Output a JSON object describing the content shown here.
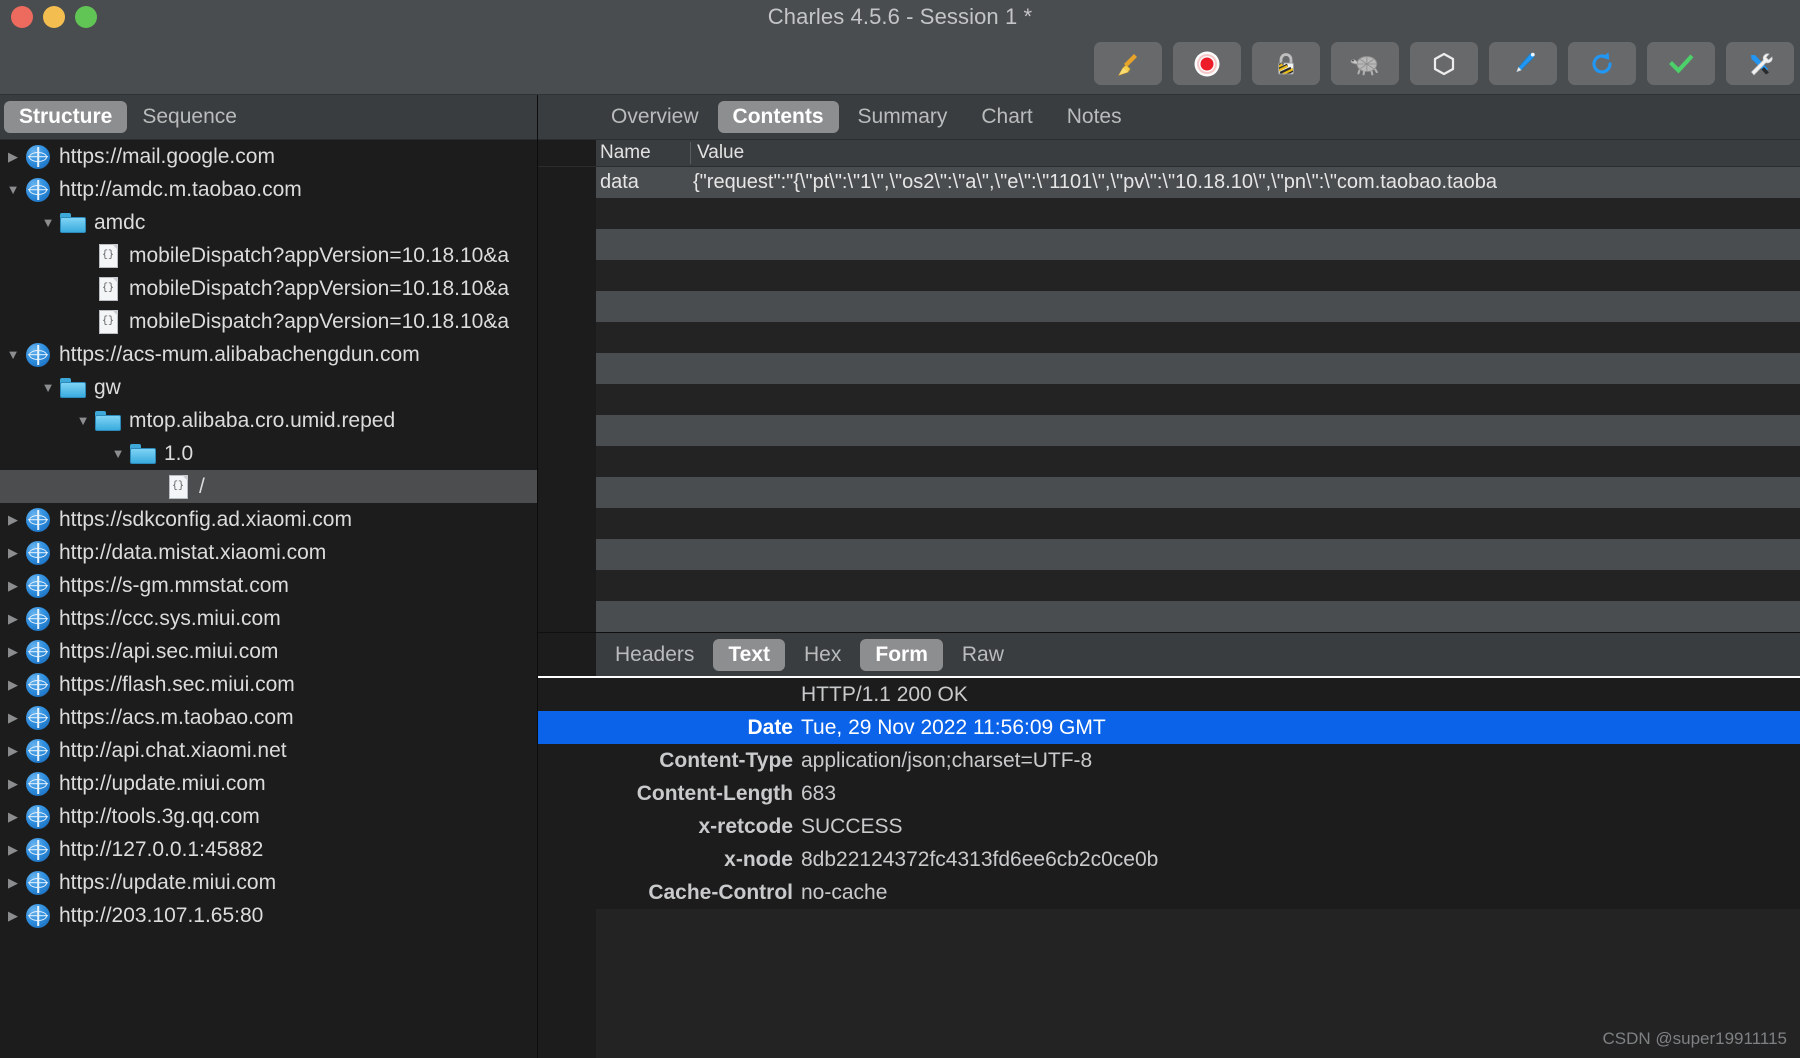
{
  "window": {
    "title": "Charles 4.5.6 - Session 1 *",
    "traffic_lights": [
      "close-red",
      "minimize-yellow",
      "zoom-green"
    ]
  },
  "toolbar": {
    "buttons": [
      {
        "name": "clear-session",
        "icon": "broom",
        "glyph": "🧹"
      },
      {
        "name": "start-stop-recording",
        "icon": "record",
        "glyph": "⏺"
      },
      {
        "name": "ssl-proxying",
        "icon": "lock",
        "glyph": "🔒"
      },
      {
        "name": "throttling",
        "icon": "turtle",
        "glyph": "🐢"
      },
      {
        "name": "breakpoints",
        "icon": "hexagon",
        "glyph": "⬡"
      },
      {
        "name": "compose",
        "icon": "pen",
        "glyph": "🖊"
      },
      {
        "name": "repeat",
        "icon": "refresh",
        "glyph": "⟳"
      },
      {
        "name": "validate",
        "icon": "checkmark",
        "glyph": "✔"
      },
      {
        "name": "tools",
        "icon": "tools",
        "glyph": "🛠"
      }
    ]
  },
  "left_panel": {
    "tabs": [
      {
        "label": "Structure",
        "active": true
      },
      {
        "label": "Sequence",
        "active": false
      }
    ],
    "tree": [
      {
        "label": "https://mail.google.com",
        "icon": "globe",
        "indent": 0,
        "arrow": "collapsed",
        "selected": false
      },
      {
        "label": "http://amdc.m.taobao.com",
        "icon": "globe",
        "indent": 0,
        "arrow": "expanded",
        "selected": false
      },
      {
        "label": "amdc",
        "icon": "folder",
        "indent": 1,
        "arrow": "expanded",
        "selected": false
      },
      {
        "label": "mobileDispatch?appVersion=10.18.10&a",
        "icon": "json",
        "indent": 2,
        "arrow": "none",
        "selected": false
      },
      {
        "label": "mobileDispatch?appVersion=10.18.10&a",
        "icon": "json",
        "indent": 2,
        "arrow": "none",
        "selected": false
      },
      {
        "label": "mobileDispatch?appVersion=10.18.10&a",
        "icon": "json",
        "indent": 2,
        "arrow": "none",
        "selected": false
      },
      {
        "label": "https://acs-mum.alibabachengdun.com",
        "icon": "globe",
        "indent": 0,
        "arrow": "expanded",
        "selected": false
      },
      {
        "label": "gw",
        "icon": "folder",
        "indent": 1,
        "arrow": "expanded",
        "selected": false
      },
      {
        "label": "mtop.alibaba.cro.umid.reped",
        "icon": "folder",
        "indent": 2,
        "arrow": "expanded",
        "selected": false
      },
      {
        "label": "1.0",
        "icon": "folder",
        "indent": 3,
        "arrow": "expanded",
        "selected": false
      },
      {
        "label": "/",
        "icon": "json",
        "indent": 4,
        "arrow": "none",
        "selected": true
      },
      {
        "label": "https://sdkconfig.ad.xiaomi.com",
        "icon": "globe",
        "indent": 0,
        "arrow": "collapsed",
        "selected": false
      },
      {
        "label": "http://data.mistat.xiaomi.com",
        "icon": "globe",
        "indent": 0,
        "arrow": "collapsed",
        "selected": false
      },
      {
        "label": "https://s-gm.mmstat.com",
        "icon": "globe",
        "indent": 0,
        "arrow": "collapsed",
        "selected": false
      },
      {
        "label": "https://ccc.sys.miui.com",
        "icon": "globe",
        "indent": 0,
        "arrow": "collapsed",
        "selected": false
      },
      {
        "label": "https://api.sec.miui.com",
        "icon": "globe",
        "indent": 0,
        "arrow": "collapsed",
        "selected": false
      },
      {
        "label": "https://flash.sec.miui.com",
        "icon": "globe",
        "indent": 0,
        "arrow": "collapsed",
        "selected": false
      },
      {
        "label": "https://acs.m.taobao.com",
        "icon": "globe",
        "indent": 0,
        "arrow": "collapsed",
        "selected": false
      },
      {
        "label": "http://api.chat.xiaomi.net",
        "icon": "globe",
        "indent": 0,
        "arrow": "collapsed",
        "selected": false
      },
      {
        "label": "http://update.miui.com",
        "icon": "globe",
        "indent": 0,
        "arrow": "collapsed",
        "selected": false
      },
      {
        "label": "http://tools.3g.qq.com",
        "icon": "globe",
        "indent": 0,
        "arrow": "collapsed",
        "selected": false
      },
      {
        "label": "http://127.0.0.1:45882",
        "icon": "globe",
        "indent": 0,
        "arrow": "collapsed",
        "selected": false
      },
      {
        "label": "https://update.miui.com",
        "icon": "globe",
        "indent": 0,
        "arrow": "collapsed",
        "selected": false
      },
      {
        "label": "http://203.107.1.65:80",
        "icon": "globe",
        "indent": 0,
        "arrow": "collapsed",
        "selected": false
      }
    ]
  },
  "right_panel": {
    "tabs": [
      {
        "label": "Overview",
        "active": false
      },
      {
        "label": "Contents",
        "active": true
      },
      {
        "label": "Summary",
        "active": false
      },
      {
        "label": "Chart",
        "active": false
      },
      {
        "label": "Notes",
        "active": false
      }
    ],
    "table": {
      "columns": [
        "Name",
        "Value"
      ],
      "rows": [
        {
          "name": "data",
          "value": "{\"request\":\"{\\\"pt\\\":\\\"1\\\",\\\"os2\\\":\\\"a\\\",\\\"e\\\":\\\"1101\\\",\\\"pv\\\":\\\"10.18.10\\\",\\\"pn\\\":\\\"com.taobao.taoba"
        }
      ],
      "empty_row_count": 14
    }
  },
  "bottom_panel": {
    "tabs": [
      {
        "label": "Headers",
        "active": false
      },
      {
        "label": "Text",
        "active": true
      },
      {
        "label": "Hex",
        "active": false
      },
      {
        "label": "Form",
        "active": true
      },
      {
        "label": "Raw",
        "active": false
      }
    ],
    "headers": [
      {
        "key": "",
        "value": "HTTP/1.1 200 OK",
        "selected": false,
        "status_line": true
      },
      {
        "key": "Date",
        "value": "Tue, 29 Nov 2022 11:56:09 GMT",
        "selected": true,
        "status_line": false
      },
      {
        "key": "Content-Type",
        "value": "application/json;charset=UTF-8",
        "selected": false,
        "status_line": false
      },
      {
        "key": "Content-Length",
        "value": "683",
        "selected": false,
        "status_line": false
      },
      {
        "key": "x-retcode",
        "value": "SUCCESS",
        "selected": false,
        "status_line": false
      },
      {
        "key": "x-node",
        "value": "8db22124372fc4313fd6ee6cb2c0ce0b",
        "selected": false,
        "status_line": false
      },
      {
        "key": "Cache-Control",
        "value": "no-cache",
        "selected": false,
        "status_line": false
      }
    ]
  },
  "watermark": {
    "text": "CSDN @super19911115"
  },
  "colors": {
    "titlebar": "#4a4d4f",
    "tree_bg": "#1c1c1c",
    "selection_blue": "#0a63e8",
    "tab_active": "#8c8e90",
    "zebra_row": "#4a4d4f"
  }
}
